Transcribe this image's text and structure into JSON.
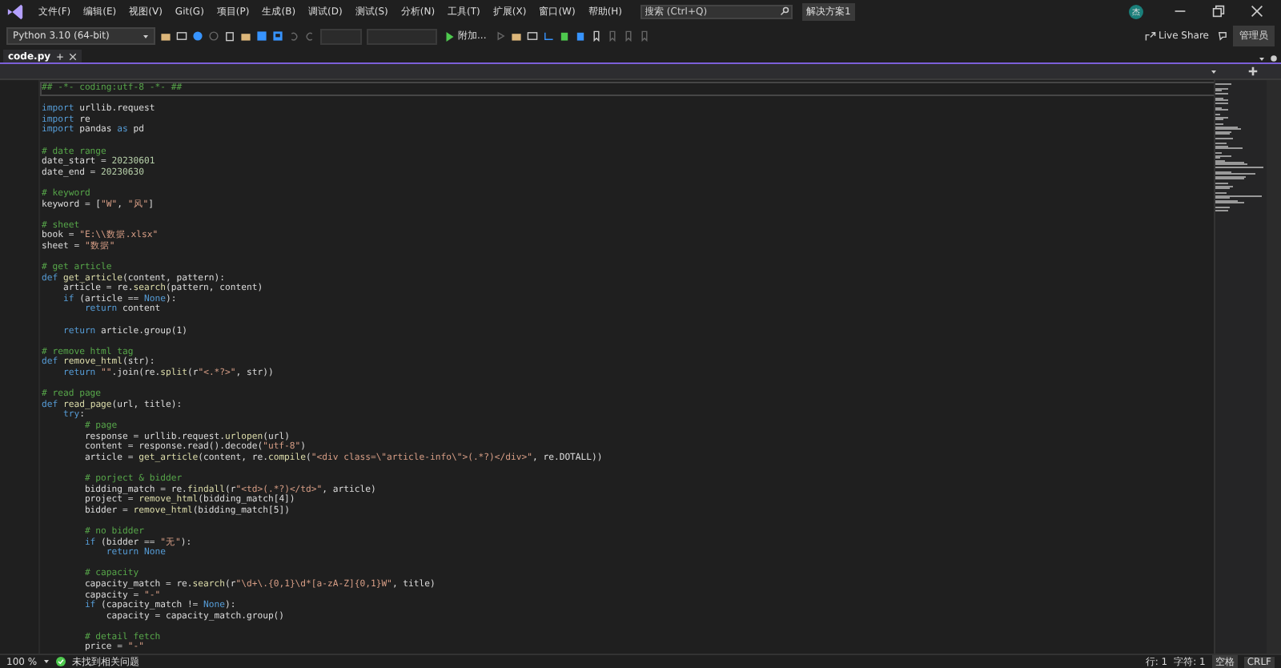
{
  "menu": [
    "文件(F)",
    "编辑(E)",
    "视图(V)",
    "Git(G)",
    "项目(P)",
    "生成(B)",
    "调试(D)",
    "测试(S)",
    "分析(N)",
    "工具(T)",
    "扩展(X)",
    "窗口(W)",
    "帮助(H)"
  ],
  "search": {
    "placeholder": "搜索 (Ctrl+Q)"
  },
  "solution": "解决方案1",
  "avatar": "杰",
  "toolbar": {
    "interpreter": "Python 3.10 (64-bit)",
    "attach": "附加...",
    "live_share": "Live Share",
    "admin": "管理员"
  },
  "tabs": [
    {
      "label": "code.py",
      "selected": true
    }
  ],
  "editor": {
    "lines": [
      {
        "tokens": [
          {
            "text": "## -*- coding:utf-8 -*- ##",
            "kind": "cm"
          }
        ]
      },
      {
        "kind": "blank"
      },
      {
        "tokens": [
          {
            "text": "import",
            "kind": "kw"
          },
          {
            "text": " urllib.request",
            "kind": "tx"
          }
        ]
      },
      {
        "tokens": [
          {
            "text": "import",
            "kind": "kw"
          },
          {
            "text": " re",
            "kind": "tx"
          }
        ]
      },
      {
        "tokens": [
          {
            "text": "import",
            "kind": "kw"
          },
          {
            "text": " pandas ",
            "kind": "tx"
          },
          {
            "text": "as",
            "kind": "kw"
          },
          {
            "text": " pd",
            "kind": "tx"
          }
        ]
      },
      {
        "kind": "blank"
      },
      {
        "tokens": [
          {
            "text": "# date range",
            "kind": "cm"
          }
        ]
      },
      {
        "tokens": [
          {
            "text": "date_start = ",
            "kind": "tx"
          },
          {
            "text": "20230601",
            "kind": "num"
          }
        ]
      },
      {
        "tokens": [
          {
            "text": "date_end = ",
            "kind": "tx"
          },
          {
            "text": "20230630",
            "kind": "num"
          }
        ]
      },
      {
        "kind": "blank"
      },
      {
        "tokens": [
          {
            "text": "# keyword",
            "kind": "cm"
          }
        ]
      },
      {
        "tokens": [
          {
            "text": "keyword = [",
            "kind": "tx"
          },
          {
            "text": "\"W\"",
            "kind": "str"
          },
          {
            "text": ", ",
            "kind": "tx"
          },
          {
            "text": "\"风\"",
            "kind": "str"
          },
          {
            "text": "]",
            "kind": "tx"
          }
        ]
      },
      {
        "kind": "blank"
      },
      {
        "tokens": [
          {
            "text": "# sheet",
            "kind": "cm"
          }
        ]
      },
      {
        "tokens": [
          {
            "text": "book = ",
            "kind": "tx"
          },
          {
            "text": "\"E:\\\\数据.xlsx\"",
            "kind": "str"
          }
        ]
      },
      {
        "tokens": [
          {
            "text": "sheet = ",
            "kind": "tx"
          },
          {
            "text": "\"数据\"",
            "kind": "str"
          }
        ]
      },
      {
        "kind": "blank"
      },
      {
        "tokens": [
          {
            "text": "# get article",
            "kind": "cm"
          }
        ]
      },
      {
        "tokens": [
          {
            "text": "def ",
            "kind": "kw"
          },
          {
            "text": "get_article",
            "kind": "fn"
          },
          {
            "text": "(content, pattern):",
            "kind": "tx"
          }
        ]
      },
      {
        "tokens": [
          {
            "text": "    article = re.",
            "kind": "tx"
          },
          {
            "text": "search",
            "kind": "fn"
          },
          {
            "text": "(pattern, content)",
            "kind": "tx"
          }
        ]
      },
      {
        "tokens": [
          {
            "text": "    if",
            "kind": "kw"
          },
          {
            "text": " (article == ",
            "kind": "tx"
          },
          {
            "text": "None",
            "kind": "kw"
          },
          {
            "text": "):",
            "kind": "tx"
          }
        ]
      },
      {
        "tokens": [
          {
            "text": "        return",
            "kind": "kw"
          },
          {
            "text": " content",
            "kind": "tx"
          }
        ]
      },
      {
        "kind": "blank"
      },
      {
        "tokens": [
          {
            "text": "    return",
            "kind": "kw"
          },
          {
            "text": " article.group(1)",
            "kind": "tx"
          }
        ]
      },
      {
        "kind": "blank"
      },
      {
        "tokens": [
          {
            "text": "# remove html tag",
            "kind": "cm"
          }
        ]
      },
      {
        "tokens": [
          {
            "text": "def ",
            "kind": "kw"
          },
          {
            "text": "remove_html",
            "kind": "fn"
          },
          {
            "text": "(str):",
            "kind": "tx"
          }
        ]
      },
      {
        "tokens": [
          {
            "text": "    return ",
            "kind": "kw"
          },
          {
            "text": "\"\"",
            "kind": "str"
          },
          {
            "text": ".join(re.",
            "kind": "tx"
          },
          {
            "text": "split",
            "kind": "fn"
          },
          {
            "text": "(r",
            "kind": "tx"
          },
          {
            "text": "\"<.*?>\"",
            "kind": "str"
          },
          {
            "text": ", str))",
            "kind": "tx"
          }
        ]
      },
      {
        "kind": "blank"
      },
      {
        "tokens": [
          {
            "text": "# read page",
            "kind": "cm"
          }
        ]
      },
      {
        "tokens": [
          {
            "text": "def ",
            "kind": "kw"
          },
          {
            "text": "read_page",
            "kind": "fn"
          },
          {
            "text": "(url, title):",
            "kind": "tx"
          }
        ]
      },
      {
        "tokens": [
          {
            "text": "    try",
            "kind": "kw"
          },
          {
            "text": ":",
            "kind": "tx"
          }
        ]
      },
      {
        "tokens": [
          {
            "text": "        # page",
            "kind": "cm"
          }
        ]
      },
      {
        "tokens": [
          {
            "text": "        response = urllib.request.",
            "kind": "tx"
          },
          {
            "text": "urlopen",
            "kind": "fn"
          },
          {
            "text": "(url)",
            "kind": "tx"
          }
        ]
      },
      {
        "tokens": [
          {
            "text": "        content = response.read().decode(",
            "kind": "tx"
          },
          {
            "text": "\"utf-8\"",
            "kind": "str"
          },
          {
            "text": ")",
            "kind": "tx"
          }
        ]
      },
      {
        "tokens": [
          {
            "text": "        article = ",
            "kind": "tx"
          },
          {
            "text": "get_article",
            "kind": "fn"
          },
          {
            "text": "(content, re.",
            "kind": "tx"
          },
          {
            "text": "compile",
            "kind": "fn"
          },
          {
            "text": "(",
            "kind": "tx"
          },
          {
            "text": "\"<div class=\\\"article-info\\\">(.*?)</div>\"",
            "kind": "str"
          },
          {
            "text": ", re.DOTALL))",
            "kind": "tx"
          }
        ]
      },
      {
        "kind": "blank"
      },
      {
        "tokens": [
          {
            "text": "        # porject & bidder",
            "kind": "cm"
          }
        ]
      },
      {
        "tokens": [
          {
            "text": "        bidding_match = re.",
            "kind": "tx"
          },
          {
            "text": "findall",
            "kind": "fn"
          },
          {
            "text": "(r",
            "kind": "tx"
          },
          {
            "text": "\"<td>(.*?)</td>\"",
            "kind": "str"
          },
          {
            "text": ", article)",
            "kind": "tx"
          }
        ]
      },
      {
        "tokens": [
          {
            "text": "        project = ",
            "kind": "tx"
          },
          {
            "text": "remove_html",
            "kind": "fn"
          },
          {
            "text": "(bidding_match[4])",
            "kind": "tx"
          }
        ]
      },
      {
        "tokens": [
          {
            "text": "        bidder = ",
            "kind": "tx"
          },
          {
            "text": "remove_html",
            "kind": "fn"
          },
          {
            "text": "(bidding_match[5])",
            "kind": "tx"
          }
        ]
      },
      {
        "kind": "blank"
      },
      {
        "tokens": [
          {
            "text": "        # no bidder",
            "kind": "cm"
          }
        ]
      },
      {
        "tokens": [
          {
            "text": "        if",
            "kind": "kw"
          },
          {
            "text": " (bidder == ",
            "kind": "tx"
          },
          {
            "text": "\"无\"",
            "kind": "str"
          },
          {
            "text": "):",
            "kind": "tx"
          }
        ]
      },
      {
        "tokens": [
          {
            "text": "            return None",
            "kind": "kw"
          }
        ]
      },
      {
        "kind": "blank"
      },
      {
        "tokens": [
          {
            "text": "        # capacity",
            "kind": "cm"
          }
        ]
      },
      {
        "tokens": [
          {
            "text": "        capacity_match = re.",
            "kind": "tx"
          },
          {
            "text": "search",
            "kind": "fn"
          },
          {
            "text": "(r",
            "kind": "tx"
          },
          {
            "text": "\"\\d+\\.{0,1}\\d*[a-zA-Z]{0,1}W\"",
            "kind": "str"
          },
          {
            "text": ", title)",
            "kind": "tx"
          }
        ]
      },
      {
        "tokens": [
          {
            "text": "        capacity = ",
            "kind": "tx"
          },
          {
            "text": "\"-\"",
            "kind": "str"
          }
        ]
      },
      {
        "tokens": [
          {
            "text": "        if",
            "kind": "kw"
          },
          {
            "text": " (capacity_match != ",
            "kind": "tx"
          },
          {
            "text": "None",
            "kind": "kw"
          },
          {
            "text": "):",
            "kind": "tx"
          }
        ]
      },
      {
        "tokens": [
          {
            "text": "            capacity = capacity_match.group()",
            "kind": "tx"
          }
        ]
      },
      {
        "kind": "blank"
      },
      {
        "tokens": [
          {
            "text": "        # detail fetch",
            "kind": "cm"
          }
        ]
      },
      {
        "tokens": [
          {
            "text": "        price = ",
            "kind": "tx"
          },
          {
            "text": "\"-\"",
            "kind": "str"
          }
        ]
      }
    ]
  },
  "status": {
    "zoom": "100 %",
    "issues": "未找到相关问题",
    "line": "行: 1",
    "char": "字符: 1",
    "spaces": "空格",
    "eol": "CRLF"
  }
}
